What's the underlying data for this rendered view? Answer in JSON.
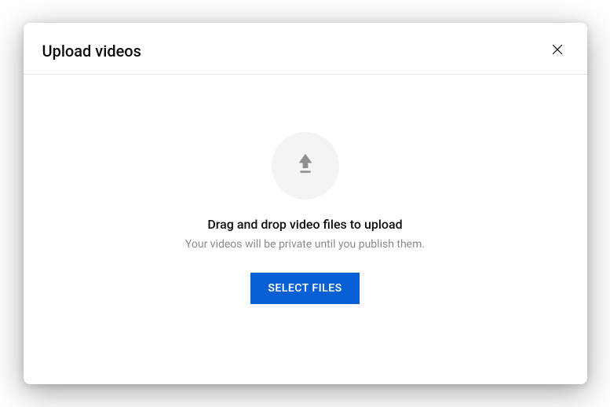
{
  "modal": {
    "title": "Upload videos",
    "heading": "Drag and drop video files to upload",
    "subtext": "Your videos will be private until you publish them.",
    "select_button": "SELECT FILES"
  },
  "icons": {
    "close": "close-icon",
    "upload": "upload-arrow-icon"
  },
  "colors": {
    "accent": "#065fd4",
    "text_primary": "#0d0d0d",
    "text_secondary": "#8b8b8b",
    "circle_bg": "#f4f4f4"
  }
}
